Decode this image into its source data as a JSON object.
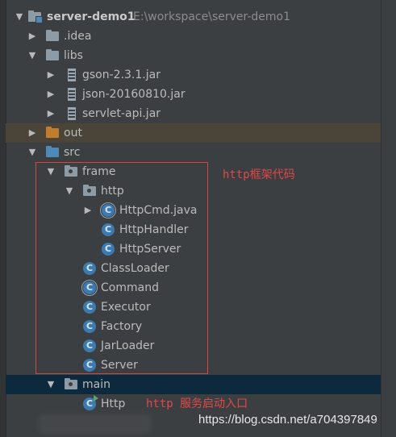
{
  "project": {
    "name": "server-demo1",
    "path": "E:\\workspace\\server-demo1"
  },
  "tree": [
    {
      "name": "server-demo1",
      "path": "E:\\workspace\\server-demo1",
      "type": "module",
      "expanded": true
    },
    {
      "name": ".idea",
      "type": "folder",
      "expanded": false
    },
    {
      "name": "libs",
      "type": "folder",
      "expanded": true
    },
    {
      "name": "gson-2.3.1.jar",
      "type": "jar",
      "expanded": false
    },
    {
      "name": "json-20160810.jar",
      "type": "jar",
      "expanded": false
    },
    {
      "name": "servlet-api.jar",
      "type": "jar",
      "expanded": false
    },
    {
      "name": "out",
      "type": "folder-excluded",
      "expanded": false
    },
    {
      "name": "src",
      "type": "folder-source",
      "expanded": true
    },
    {
      "name": "frame",
      "type": "package",
      "expanded": true
    },
    {
      "name": "http",
      "type": "package",
      "expanded": true
    },
    {
      "name": "HttpCmd.java",
      "type": "java-file",
      "expanded": false
    },
    {
      "name": "HttpHandler",
      "type": "class"
    },
    {
      "name": "HttpServer",
      "type": "class"
    },
    {
      "name": "ClassLoader",
      "type": "class"
    },
    {
      "name": "Command",
      "type": "class"
    },
    {
      "name": "Executor",
      "type": "class"
    },
    {
      "name": "Factory",
      "type": "class"
    },
    {
      "name": "JarLoader",
      "type": "class"
    },
    {
      "name": "Server",
      "type": "class"
    },
    {
      "name": "main",
      "type": "package",
      "expanded": true
    },
    {
      "name": "Http",
      "type": "runnable-class"
    }
  ],
  "annotations": {
    "frame_note": "http框架代码",
    "main_note": "http 服务启动入口"
  },
  "watermark": "https://blog.csdn.net/a704397849",
  "colors": {
    "background": "#3c3f41",
    "selected_row": "#0d293e",
    "excluded_row": "#4a4538",
    "annotation_red": "#e04848",
    "class_icon": "#3d7ab0",
    "source_folder": "#4d8ab5",
    "excluded_folder": "#c17c2d"
  },
  "icons": {
    "expanded": "arrow-down-icon",
    "collapsed": "arrow-right-icon",
    "folder": "folder-icon",
    "jar": "jar-icon",
    "class": "class-icon",
    "package": "package-icon"
  }
}
